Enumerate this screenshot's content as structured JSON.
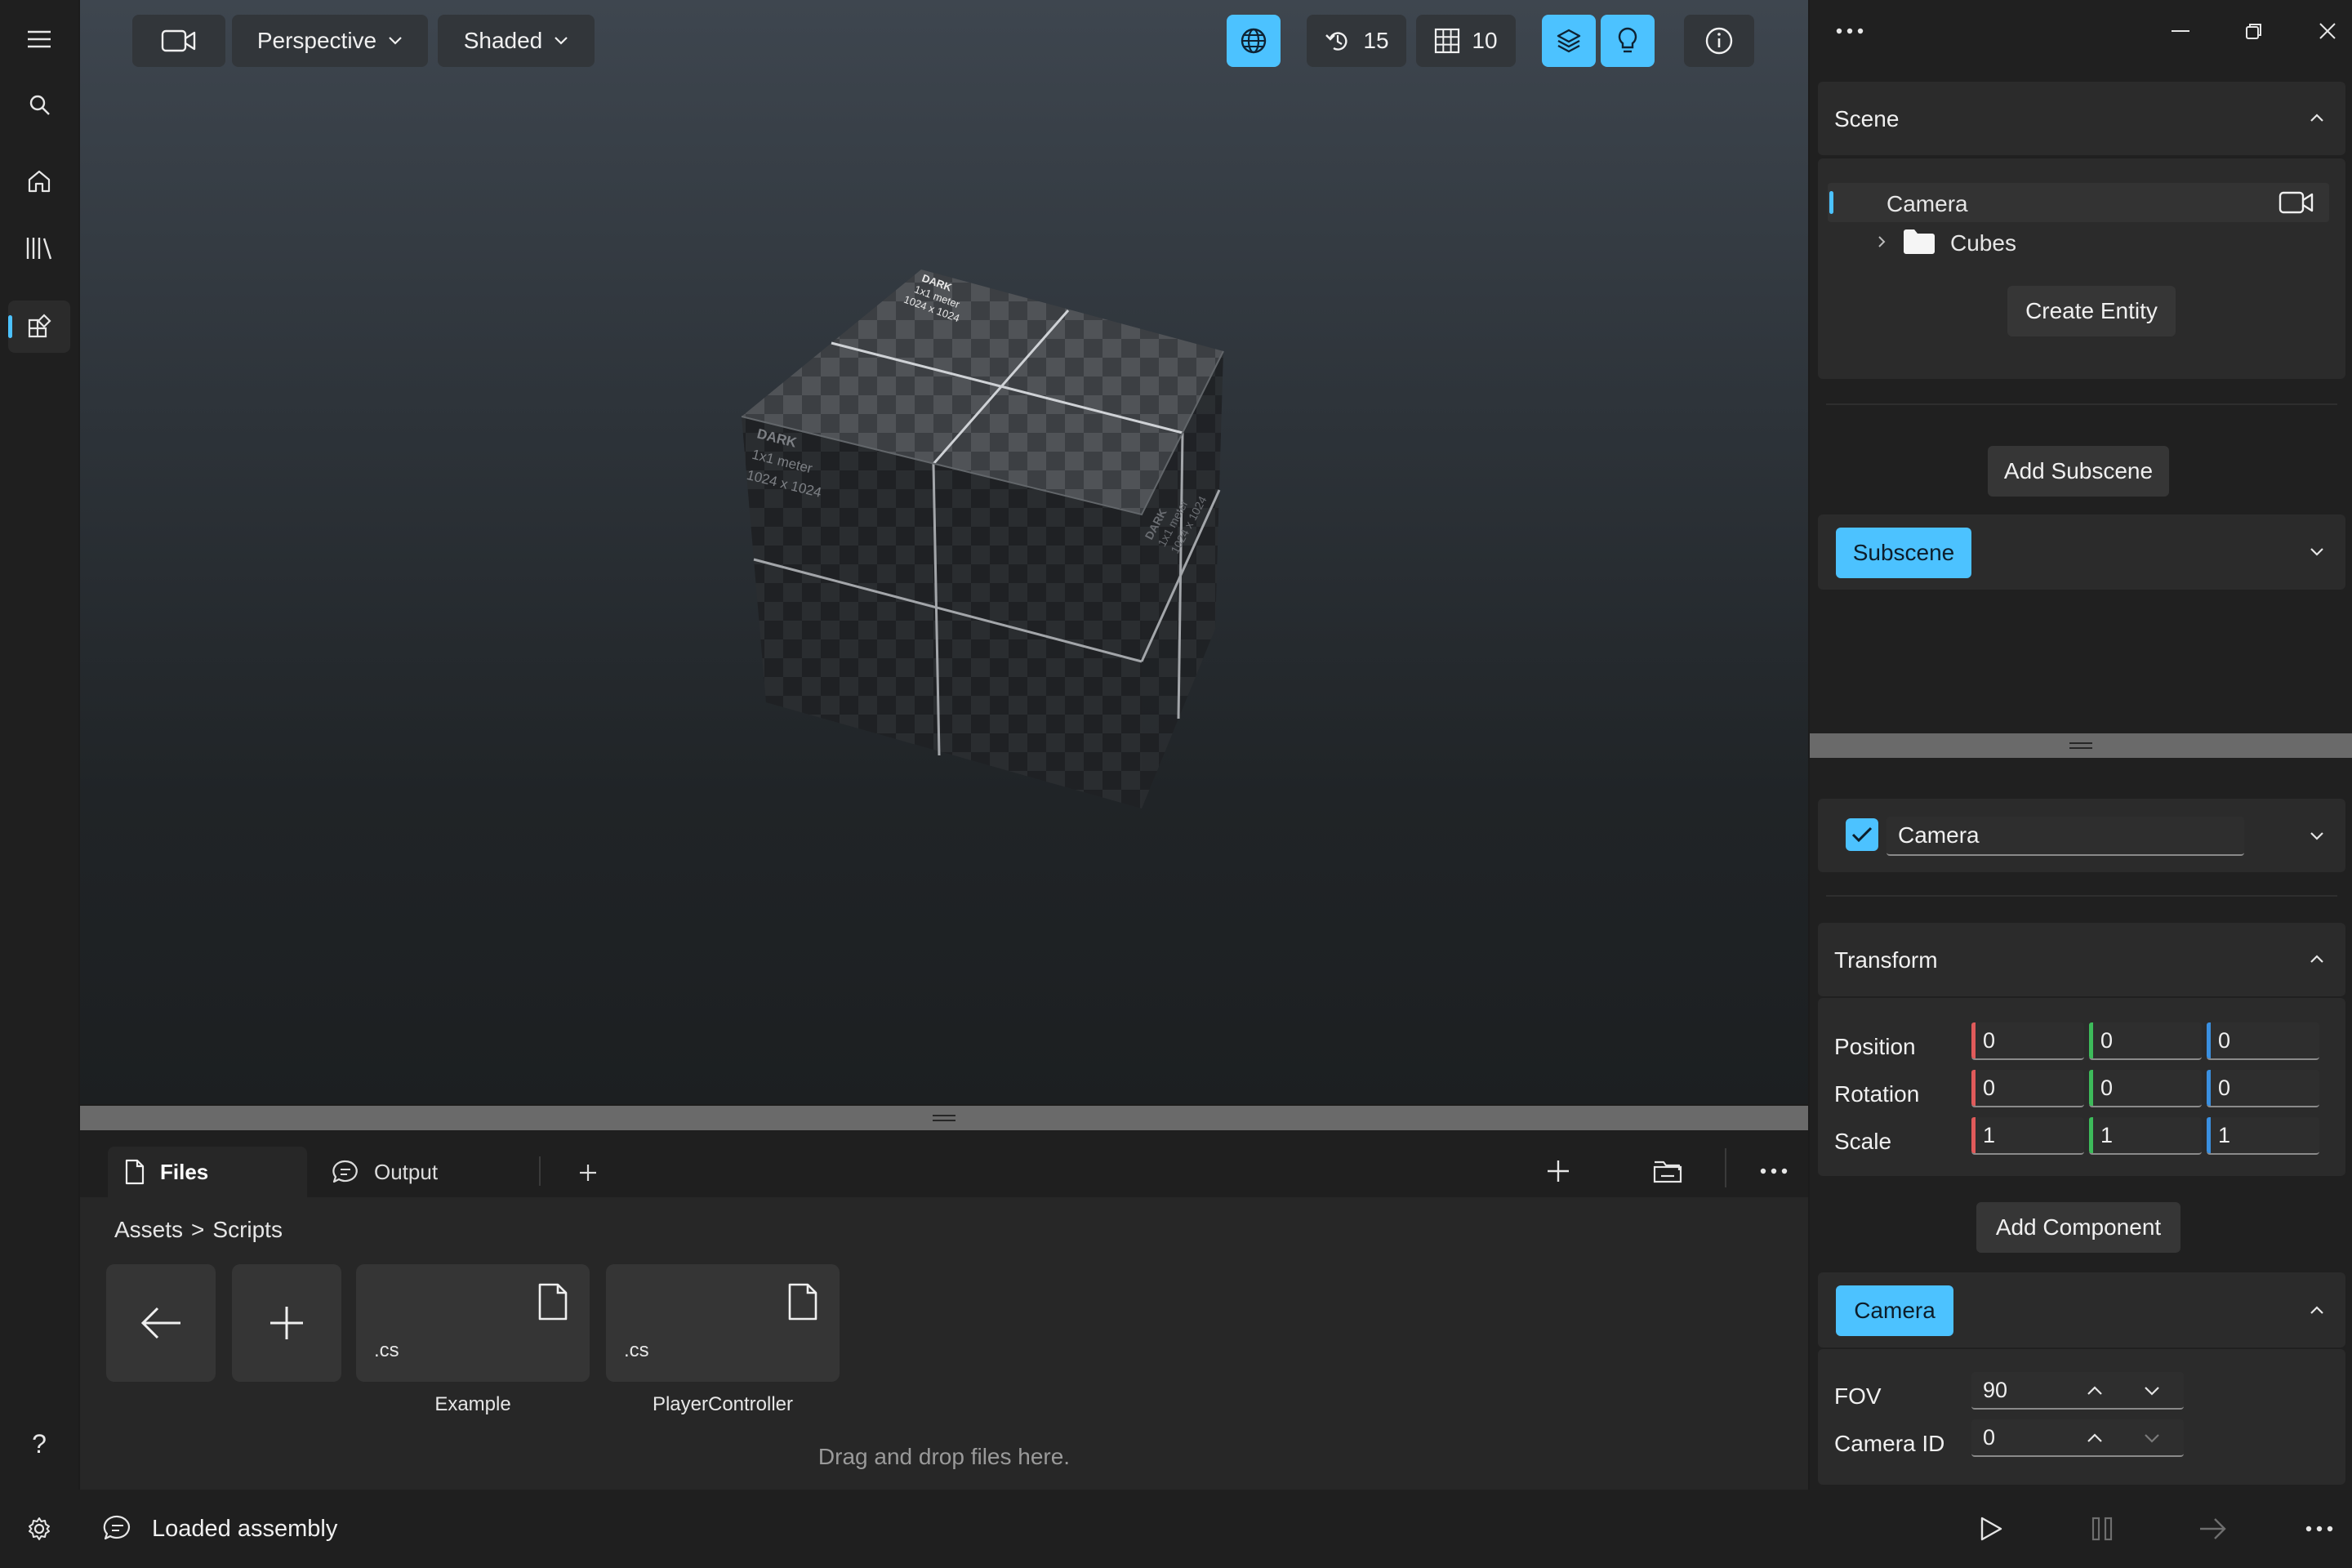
{
  "rail": {
    "items": [
      "menu",
      "search",
      "home",
      "library",
      "scene-editor"
    ],
    "help_label": "?",
    "settings": "settings"
  },
  "viewport": {
    "projection": "Perspective",
    "shading": "Shaded",
    "snap_angle": "15",
    "grid_size": "10",
    "cube_text": {
      "title": "DARK",
      "size": "1x1 meter",
      "resolution": "1024 x 1024"
    }
  },
  "files": {
    "tabs": [
      {
        "label": "Files",
        "active": true
      },
      {
        "label": "Output",
        "active": false
      }
    ],
    "breadcrumb": [
      "Assets",
      "Scripts"
    ],
    "breadcrumb_sep": ">",
    "items": [
      {
        "ext": ".cs",
        "name": "Example"
      },
      {
        "ext": ".cs",
        "name": "PlayerController"
      }
    ],
    "drop_hint": "Drag and drop files here."
  },
  "scene": {
    "title": "Scene",
    "entities": [
      {
        "name": "Camera",
        "selected": true
      },
      {
        "name": "Cubes",
        "selected": false
      }
    ],
    "create_entity": "Create Entity",
    "add_subscene": "Add Subscene",
    "subscene_label": "Subscene"
  },
  "inspector": {
    "entity_name": "Camera",
    "enabled": true,
    "transform": {
      "title": "Transform",
      "rows": [
        {
          "label": "Position",
          "x": "0",
          "y": "0",
          "z": "0"
        },
        {
          "label": "Rotation",
          "x": "0",
          "y": "0",
          "z": "0"
        },
        {
          "label": "Scale",
          "x": "1",
          "y": "1",
          "z": "1"
        }
      ]
    },
    "add_component": "Add Component",
    "camera": {
      "title": "Camera",
      "fov_label": "FOV",
      "fov": "90",
      "id_label": "Camera ID",
      "id": "0"
    }
  },
  "status": {
    "message": "Loaded assembly"
  },
  "colors": {
    "accent": "#4cc2ff",
    "axis_x": "#e05a5a",
    "axis_y": "#3dbb5a",
    "axis_z": "#3a8fe0"
  }
}
